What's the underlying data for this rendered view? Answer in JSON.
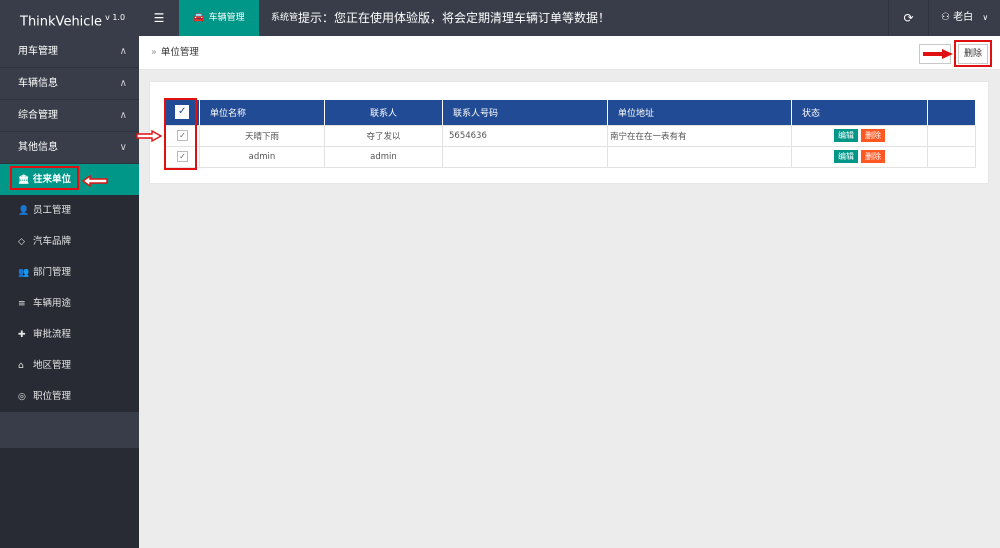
{
  "app": {
    "name": "ThinkVehicle",
    "version": "v 1.0"
  },
  "topbar": {
    "active_tab": "车辆管理",
    "tab2": "系统管",
    "notice": "提示：您正在使用体验版，将会定期清理车辆订单等数据！",
    "user": "老白"
  },
  "sidebar": {
    "groups": [
      {
        "label": "用车管理",
        "caret": "∧"
      },
      {
        "label": "车辆信息",
        "caret": "∧"
      },
      {
        "label": "综合管理",
        "caret": "∧"
      },
      {
        "label": "其他信息",
        "caret": "∨"
      }
    ],
    "items": [
      {
        "label": "往来单位",
        "icon": "bank-icon",
        "glyph": "🏛"
      },
      {
        "label": "员工管理",
        "icon": "user-icon",
        "glyph": "👤"
      },
      {
        "label": "汽车品牌",
        "icon": "diamond-icon",
        "glyph": "◇"
      },
      {
        "label": "部门管理",
        "icon": "group-icon",
        "glyph": "👥"
      },
      {
        "label": "车辆用途",
        "icon": "list-icon",
        "glyph": "≡"
      },
      {
        "label": "审批流程",
        "icon": "puzzle-icon",
        "glyph": "✚"
      },
      {
        "label": "地区管理",
        "icon": "home-icon",
        "glyph": "⌂"
      },
      {
        "label": "职位管理",
        "icon": "camera-icon",
        "glyph": "◎"
      }
    ]
  },
  "breadcrumb": {
    "sep": "»",
    "label": "单位管理"
  },
  "toolbar": {
    "delete_label": "删除"
  },
  "table": {
    "columns": [
      "单位名称",
      "联系人",
      "联系人号码",
      "单位地址",
      "状态"
    ],
    "rows": [
      {
        "name": "天晴下雨",
        "contact": "夺了发以",
        "phone": "5654636",
        "address": "南宁在在在一表有有"
      },
      {
        "name": "admin",
        "contact": "admin",
        "phone": "",
        "address": ""
      }
    ],
    "edit_label": "编辑",
    "delete_label": "删除"
  },
  "colors": {
    "accent": "#009688",
    "header": "#214b94",
    "danger": "#ff5722",
    "highlight": "#e01010",
    "dark": "#393d49"
  }
}
